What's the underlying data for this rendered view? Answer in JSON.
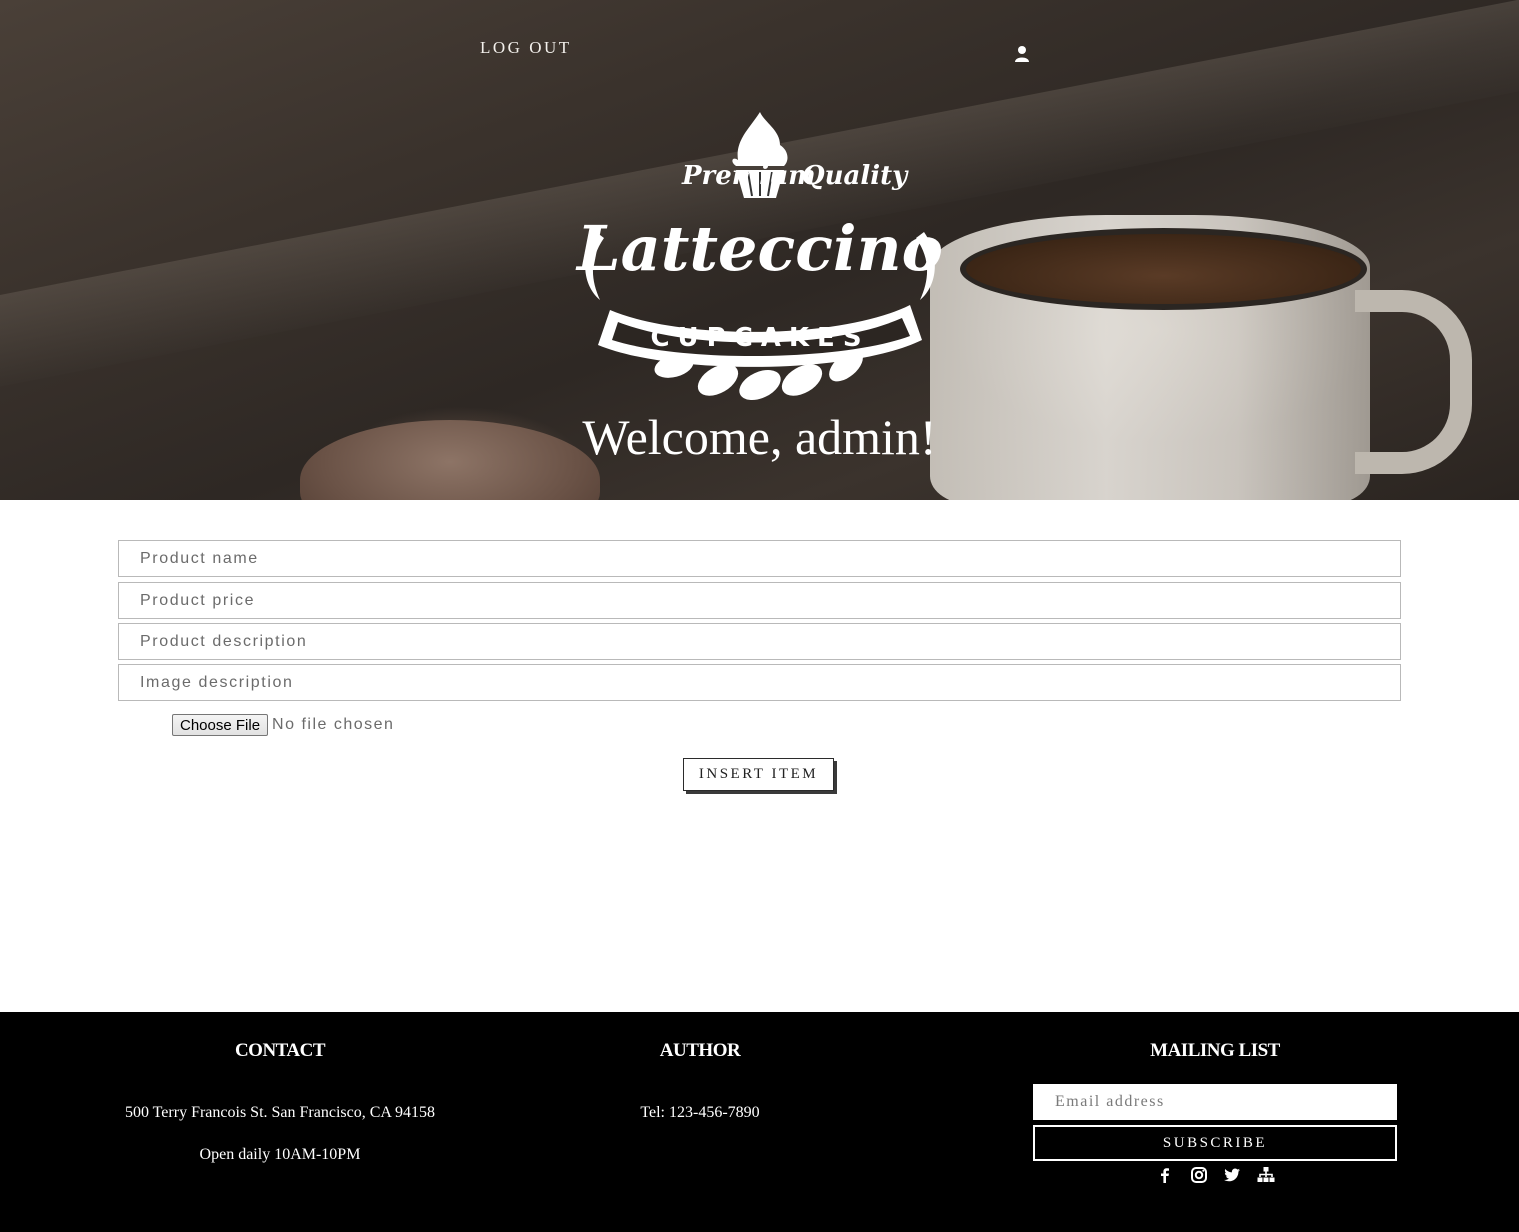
{
  "header": {
    "logout_label": "LOG OUT",
    "welcome_text": "Welcome, admin!",
    "user_icon": "user-icon"
  },
  "logo": {
    "tagline_left": "Premium",
    "tagline_right": "Quality",
    "brand": "Latteccino",
    "ribbon": "CUPCAKES"
  },
  "form": {
    "product_name_placeholder": "Product name",
    "product_price_placeholder": "Product price",
    "product_description_placeholder": "Product description",
    "image_description_placeholder": "Image description",
    "choose_file_label": "Choose File",
    "file_status": "No file chosen",
    "insert_label": "INSERT ITEM"
  },
  "footer": {
    "contact": {
      "title": "CONTACT",
      "address": "500 Terry Francois St. San Francisco, CA 94158",
      "hours": "Open daily 10AM-10PM"
    },
    "author": {
      "title": "AUTHOR",
      "tel": "Tel: 123-456-7890"
    },
    "mailing": {
      "title": "MAILING LIST",
      "email_placeholder": "Email address",
      "subscribe_label": "SUBSCRIBE"
    },
    "social_icons": [
      "facebook-icon",
      "instagram-icon",
      "twitter-icon",
      "sitemap-icon"
    ]
  }
}
